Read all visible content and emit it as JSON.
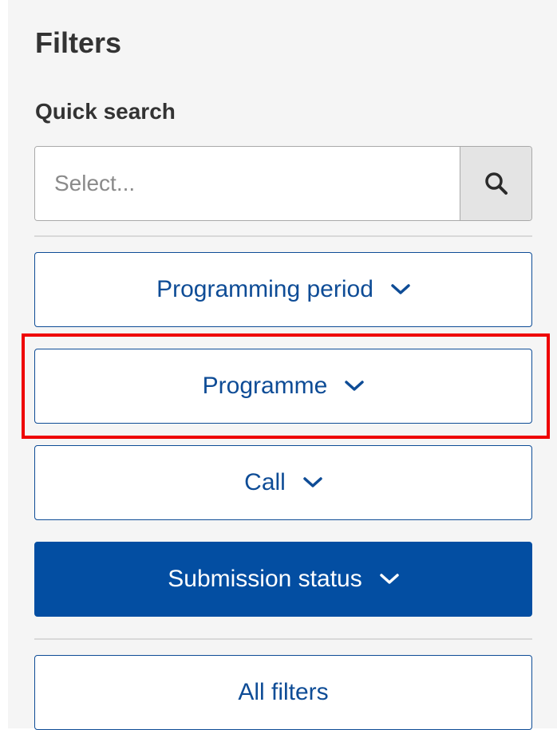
{
  "filters": {
    "title": "Filters",
    "quick_search": {
      "label": "Quick search",
      "placeholder": "Select...",
      "value": "",
      "button_icon": "search-icon"
    },
    "dropdowns": [
      {
        "label": "Programming period",
        "icon": "chevron-down-icon",
        "active": false
      },
      {
        "label": "Programme",
        "icon": "chevron-down-icon",
        "active": false,
        "highlighted": true
      },
      {
        "label": "Call",
        "icon": "chevron-down-icon",
        "active": false
      },
      {
        "label": "Submission status",
        "icon": "chevron-down-icon",
        "active": true
      }
    ],
    "all_filters_label": "All filters"
  },
  "colors": {
    "accent": "#034ea2",
    "highlight": "#ee0000"
  }
}
